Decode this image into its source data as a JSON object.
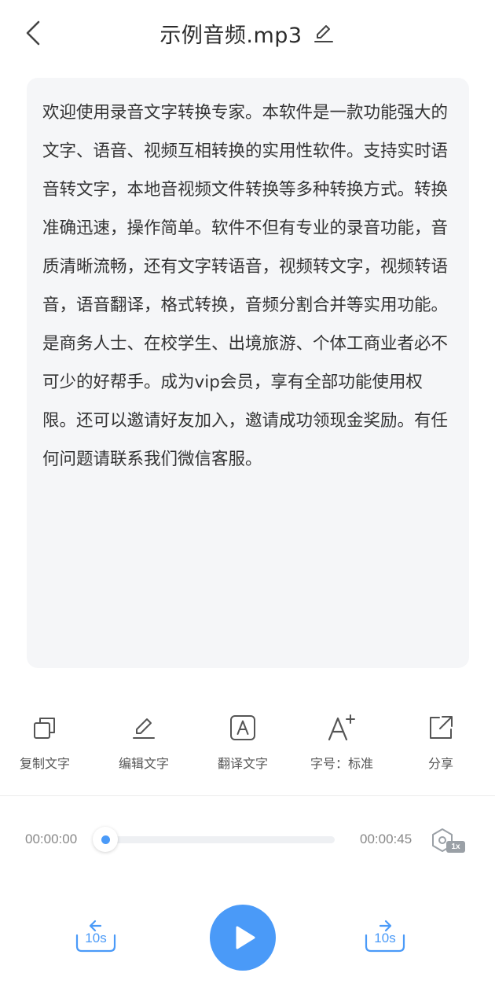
{
  "header": {
    "title": "示例音频.mp3",
    "back_icon": "chevron-left-icon",
    "edit_icon": "pencil-icon"
  },
  "transcript": {
    "text": "欢迎使用录音文字转换专家。本软件是一款功能强大的文字、语音、视频互相转换的实用性软件。支持实时语音转文字，本地音视频文件转换等多种转换方式。转换准确迅速，操作简单。软件不但有专业的录音功能，音质清晰流畅，还有文字转语音，视频转文字，视频转语音，语音翻译，格式转换，音频分割合并等实用功能。是商务人士、在校学生、出境旅游、个体工商业者必不可少的好帮手。成为vip会员，享有全部功能使用权限。还可以邀请好友加入，邀请成功领现金奖励。有任何问题请联系我们微信客服。"
  },
  "toolbar": {
    "items": [
      {
        "label": "复制文字",
        "icon": "copy-icon"
      },
      {
        "label": "编辑文字",
        "icon": "edit-icon"
      },
      {
        "label": "翻译文字",
        "icon": "translate-icon"
      },
      {
        "label": "字号：标准",
        "icon": "font-size-icon"
      },
      {
        "label": "分享",
        "icon": "share-icon"
      }
    ]
  },
  "player": {
    "current_time": "00:00:00",
    "total_time": "00:00:45",
    "progress_fraction": 0.0,
    "speed": "1x",
    "rewind_label": "10s",
    "forward_label": "10s",
    "play_icon": "play-icon",
    "accent_color": "#4a9af8"
  }
}
